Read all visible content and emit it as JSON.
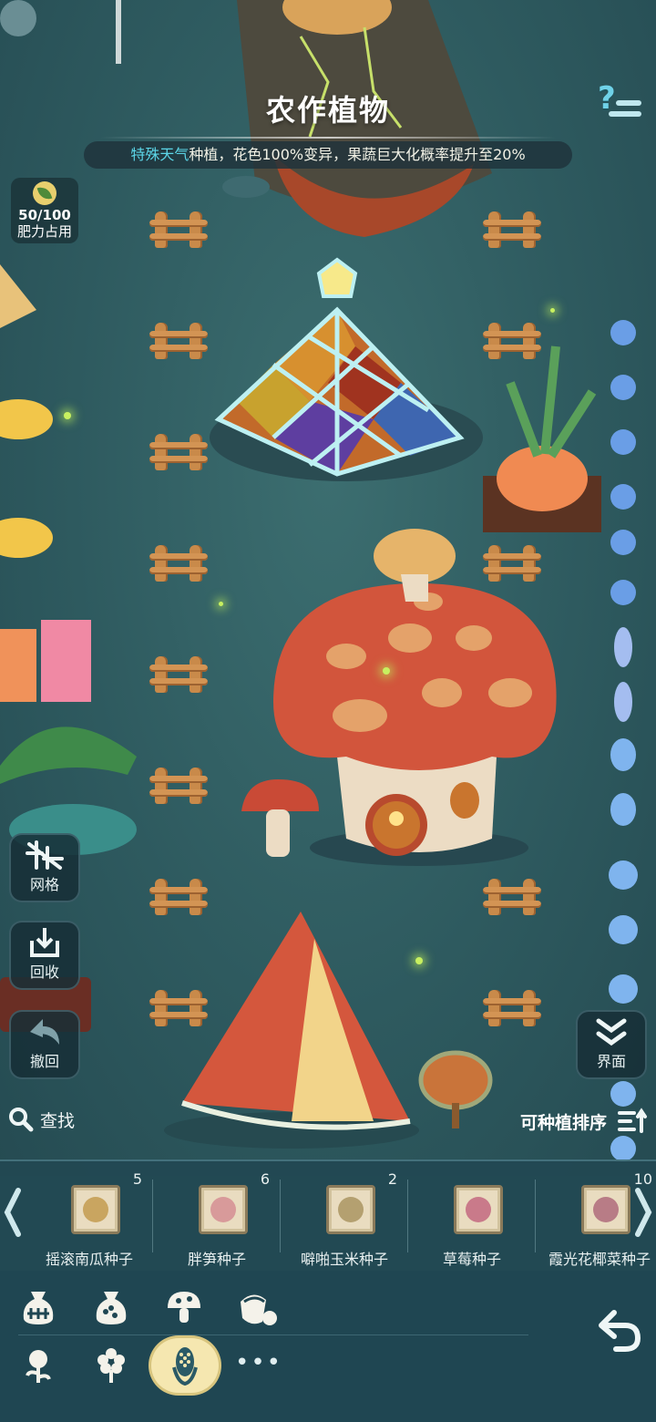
{
  "header": {
    "title": "农作植物",
    "weather_highlight": "特殊天气",
    "weather_rest": "种植，花色100%变异，果蔬巨大化概率提升至20%"
  },
  "fertilizer": {
    "value": "50/100",
    "label": "肥力占用"
  },
  "tools": {
    "grid_label": "网格",
    "recycle_label": "回收",
    "undo_label": "撤回",
    "interface_label": "界面"
  },
  "find_label": "查找",
  "sort_label": "可种植排序",
  "seeds": [
    {
      "name": "摇滚南瓜种子",
      "count": "5",
      "color": "#c9a560"
    },
    {
      "name": "胖笋种子",
      "count": "6",
      "color": "#d89a9a"
    },
    {
      "name": "噼啪玉米种子",
      "count": "2",
      "color": "#b4a070"
    },
    {
      "name": "草莓种子",
      "count": "",
      "color": "#c97a8a"
    },
    {
      "name": "霞光花椰菜种子",
      "count": "10",
      "color": "#b87c86"
    }
  ],
  "icons": {
    "help": "question-icon",
    "grid": "grid-toggle-icon",
    "recycle": "recycle-icon",
    "undo": "undo-icon",
    "interface": "double-chevron-down-icon",
    "find": "search-icon",
    "sort": "sort-icon",
    "back": "return-arrow-icon"
  },
  "colors": {
    "accent_cyan": "#5cd6e8",
    "tray_bg": "#22485a",
    "active_tab": "#f5e7b0"
  }
}
